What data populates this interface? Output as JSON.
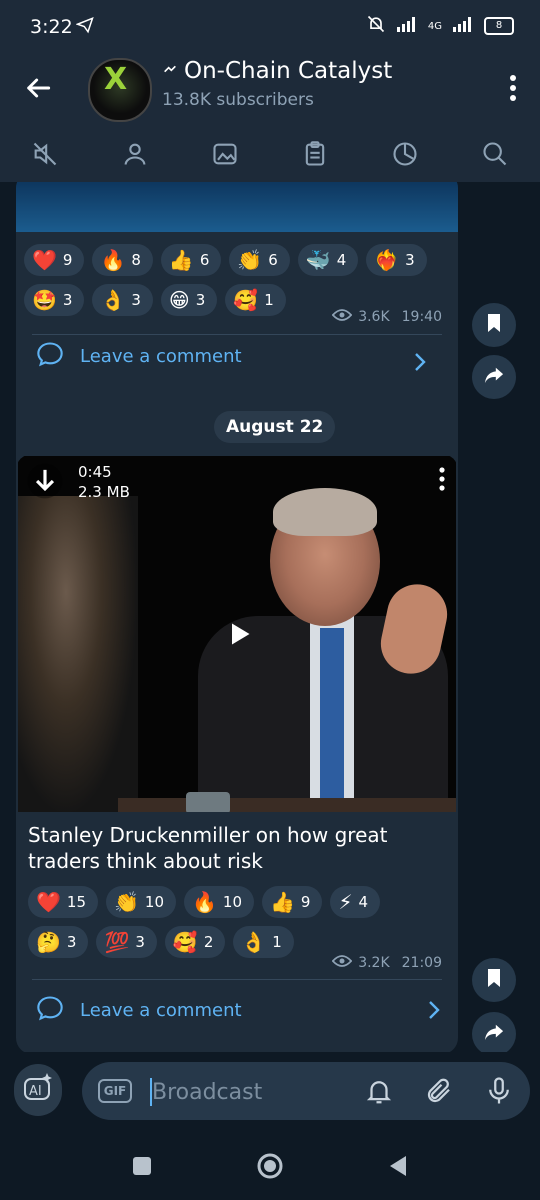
{
  "status_bar": {
    "time": "3:22",
    "network": "4G",
    "battery": "8"
  },
  "header": {
    "title": "On-Chain Catalyst",
    "subscribers": "13.8K subscribers"
  },
  "tabs": [
    "mute",
    "members",
    "media",
    "files",
    "stats",
    "search"
  ],
  "post1": {
    "reactions": [
      {
        "emoji": "❤️",
        "count": "9"
      },
      {
        "emoji": "🔥",
        "count": "8"
      },
      {
        "emoji": "👍",
        "count": "6"
      },
      {
        "emoji": "👏",
        "count": "6"
      },
      {
        "emoji": "🐳",
        "count": "4"
      },
      {
        "emoji": "❤️‍🔥",
        "count": "3"
      },
      {
        "emoji": "🤩",
        "count": "3"
      },
      {
        "emoji": "👌",
        "count": "3"
      },
      {
        "emoji": "😁",
        "count": "3"
      },
      {
        "emoji": "🥰",
        "count": "1"
      }
    ],
    "views": "3.6K",
    "time": "19:40",
    "comment_label": "Leave a comment"
  },
  "date_separator": "August 22",
  "post2": {
    "video": {
      "duration": "0:45",
      "size": "2.3 MB"
    },
    "caption": "Stanley Druckenmiller on how great traders think about risk",
    "reactions": [
      {
        "emoji": "❤️",
        "count": "15"
      },
      {
        "emoji": "👏",
        "count": "10"
      },
      {
        "emoji": "🔥",
        "count": "10"
      },
      {
        "emoji": "👍",
        "count": "9"
      },
      {
        "emoji": "⚡",
        "count": "4"
      },
      {
        "emoji": "🤔",
        "count": "3"
      },
      {
        "emoji": "💯",
        "count": "3"
      },
      {
        "emoji": "🥰",
        "count": "2"
      },
      {
        "emoji": "👌",
        "count": "1"
      }
    ],
    "views": "3.2K",
    "time": "21:09",
    "comment_label": "Leave a comment"
  },
  "input": {
    "placeholder": "Broadcast",
    "gif_label": "GIF",
    "ai_label": "AI"
  },
  "colors": {
    "accent": "#5fb3f3",
    "bubble": "#1e2c3a",
    "header": "#1d2a39"
  }
}
